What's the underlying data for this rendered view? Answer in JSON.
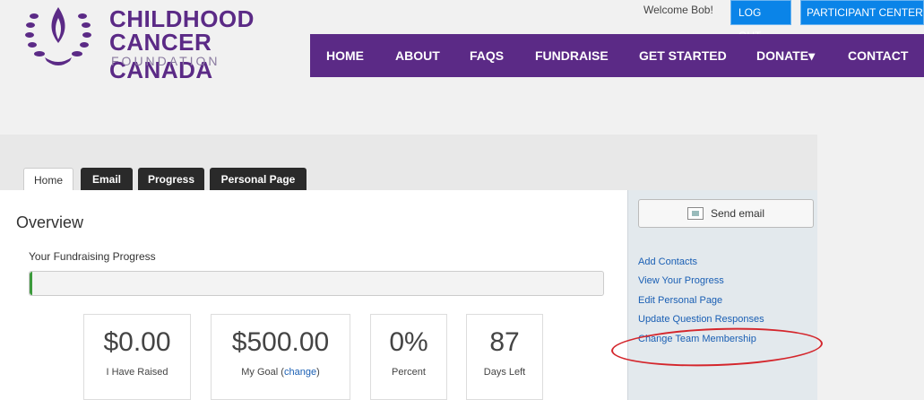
{
  "logo": {
    "line1": "CHILDHOOD",
    "line2": "CANCER CANADA",
    "line3": "FOUNDATION",
    "icon": "flame-laurel-icon"
  },
  "header": {
    "welcome": "Welcome Bob!",
    "logout": "LOG OUT",
    "participant_center": "PARTICIPANT CENTER"
  },
  "nav": {
    "items": [
      "HOME",
      "ABOUT",
      "FAQS",
      "FUNDRAISE",
      "GET STARTED",
      "DONATE",
      "CONTACT"
    ],
    "donate_caret": "▾"
  },
  "tabs": [
    "Home",
    "Email",
    "Progress",
    "Personal Page"
  ],
  "main": {
    "title": "Overview",
    "progress_label": "Your Fundraising Progress",
    "progress_fraction": 0.004
  },
  "stats": [
    {
      "value": "$0.00",
      "label": "I Have Raised"
    },
    {
      "value": "$500.00",
      "label": "My Goal",
      "link": "change"
    },
    {
      "value": "0%",
      "label": "Percent"
    },
    {
      "value": "87",
      "label": "Days Left"
    }
  ],
  "sidebar": {
    "send_email": "Send email",
    "links": [
      "Add Contacts",
      "View Your Progress",
      "Edit Personal Page",
      "Update Question Responses",
      "Change Team Membership"
    ]
  },
  "colors": {
    "brand_purple": "#5b2a86",
    "button_blue": "#0a84e8",
    "link_blue": "#1a5fb4",
    "annotation_red": "#d4262c",
    "progress_green": "#3c9a3c"
  }
}
